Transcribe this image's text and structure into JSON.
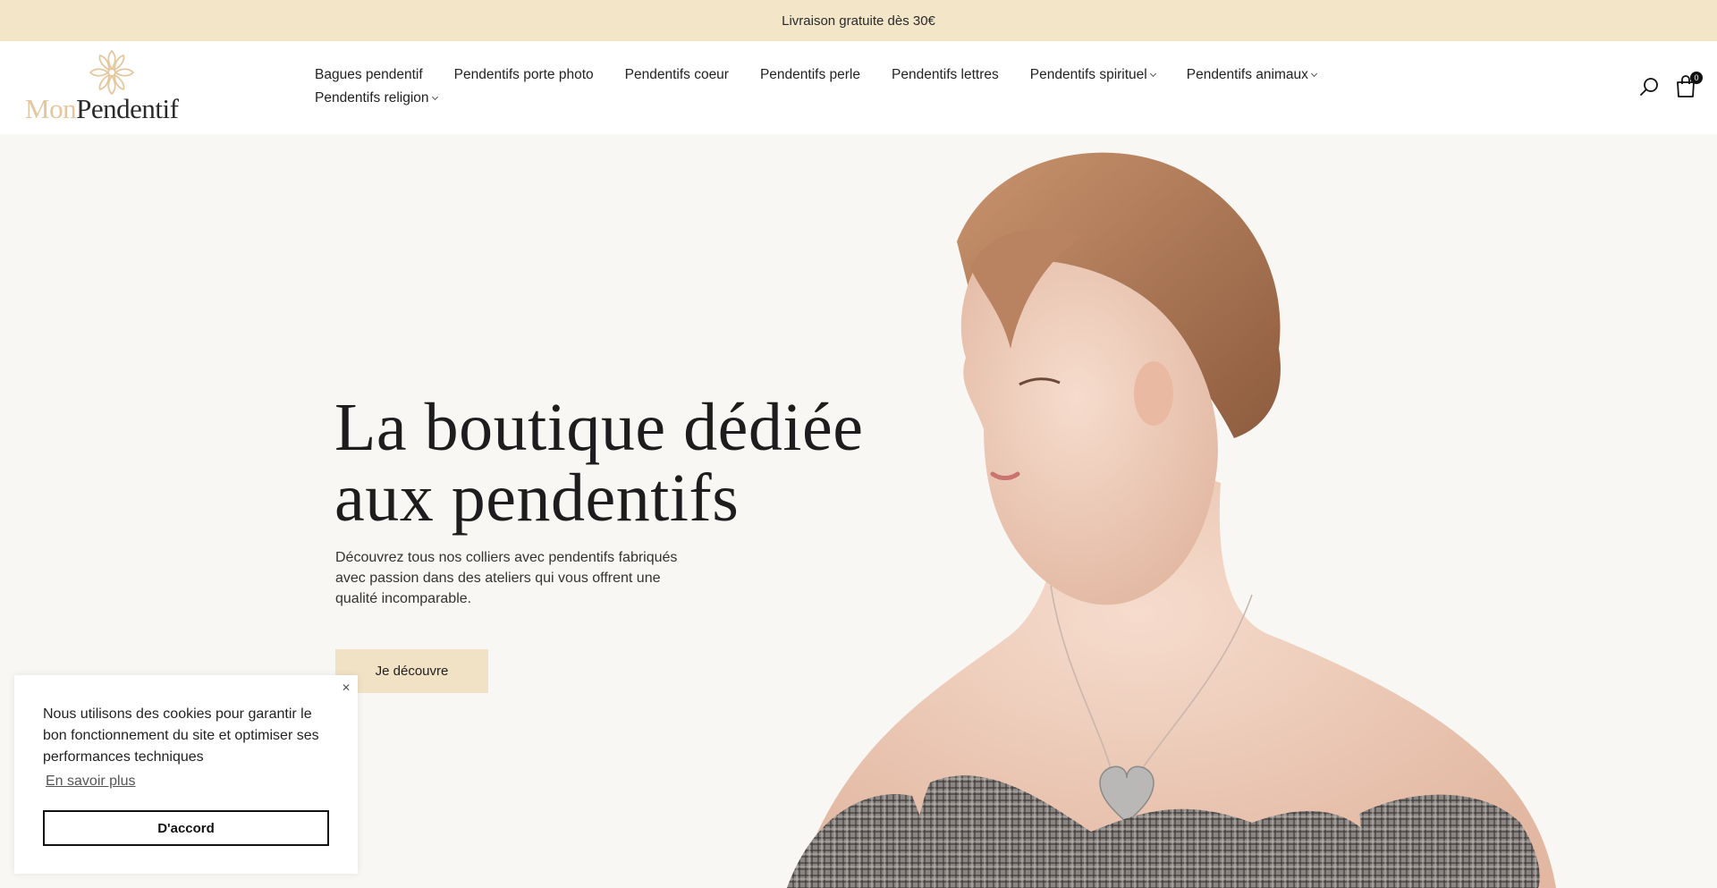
{
  "announcement": {
    "text": "Livraison gratuite dès 30€"
  },
  "brand": {
    "logo_part1": "Mon",
    "logo_part2": "Pendentif",
    "logo_icon": "ornament-logo-icon"
  },
  "nav": {
    "items": [
      {
        "label": "Bagues pendentif",
        "has_dropdown": false
      },
      {
        "label": "Pendentifs porte photo",
        "has_dropdown": false
      },
      {
        "label": "Pendentifs coeur",
        "has_dropdown": false
      },
      {
        "label": "Pendentifs perle",
        "has_dropdown": false
      },
      {
        "label": "Pendentifs lettres",
        "has_dropdown": false
      },
      {
        "label": "Pendentifs spirituel",
        "has_dropdown": true
      },
      {
        "label": "Pendentifs animaux",
        "has_dropdown": true
      },
      {
        "label": "Pendentifs religion",
        "has_dropdown": true
      }
    ]
  },
  "header_actions": {
    "search_icon": "search-icon",
    "cart_icon": "shopping-bag-icon",
    "cart_count": "0"
  },
  "hero": {
    "title_line1": "La boutique dédiée",
    "title_line2": "aux pendentifs",
    "description": "Découvrez tous nos colliers avec pendentifs fabriqués avec passion dans des ateliers qui vous offrent une qualité incomparable.",
    "cta_label": "Je découvre"
  },
  "cookie_banner": {
    "text": "Nous utilisons des cookies pour garantir le bon fonctionnement du site et optimiser ses performances techniques",
    "link_label": "En savoir plus",
    "accept_label": "D'accord",
    "close_icon": "close-icon"
  },
  "colors": {
    "announcement_bg": "#f3e5c8",
    "accent": "#e5c79e",
    "cta_bg": "#f1e1c5",
    "hero_bg": "#f9f7f3"
  }
}
